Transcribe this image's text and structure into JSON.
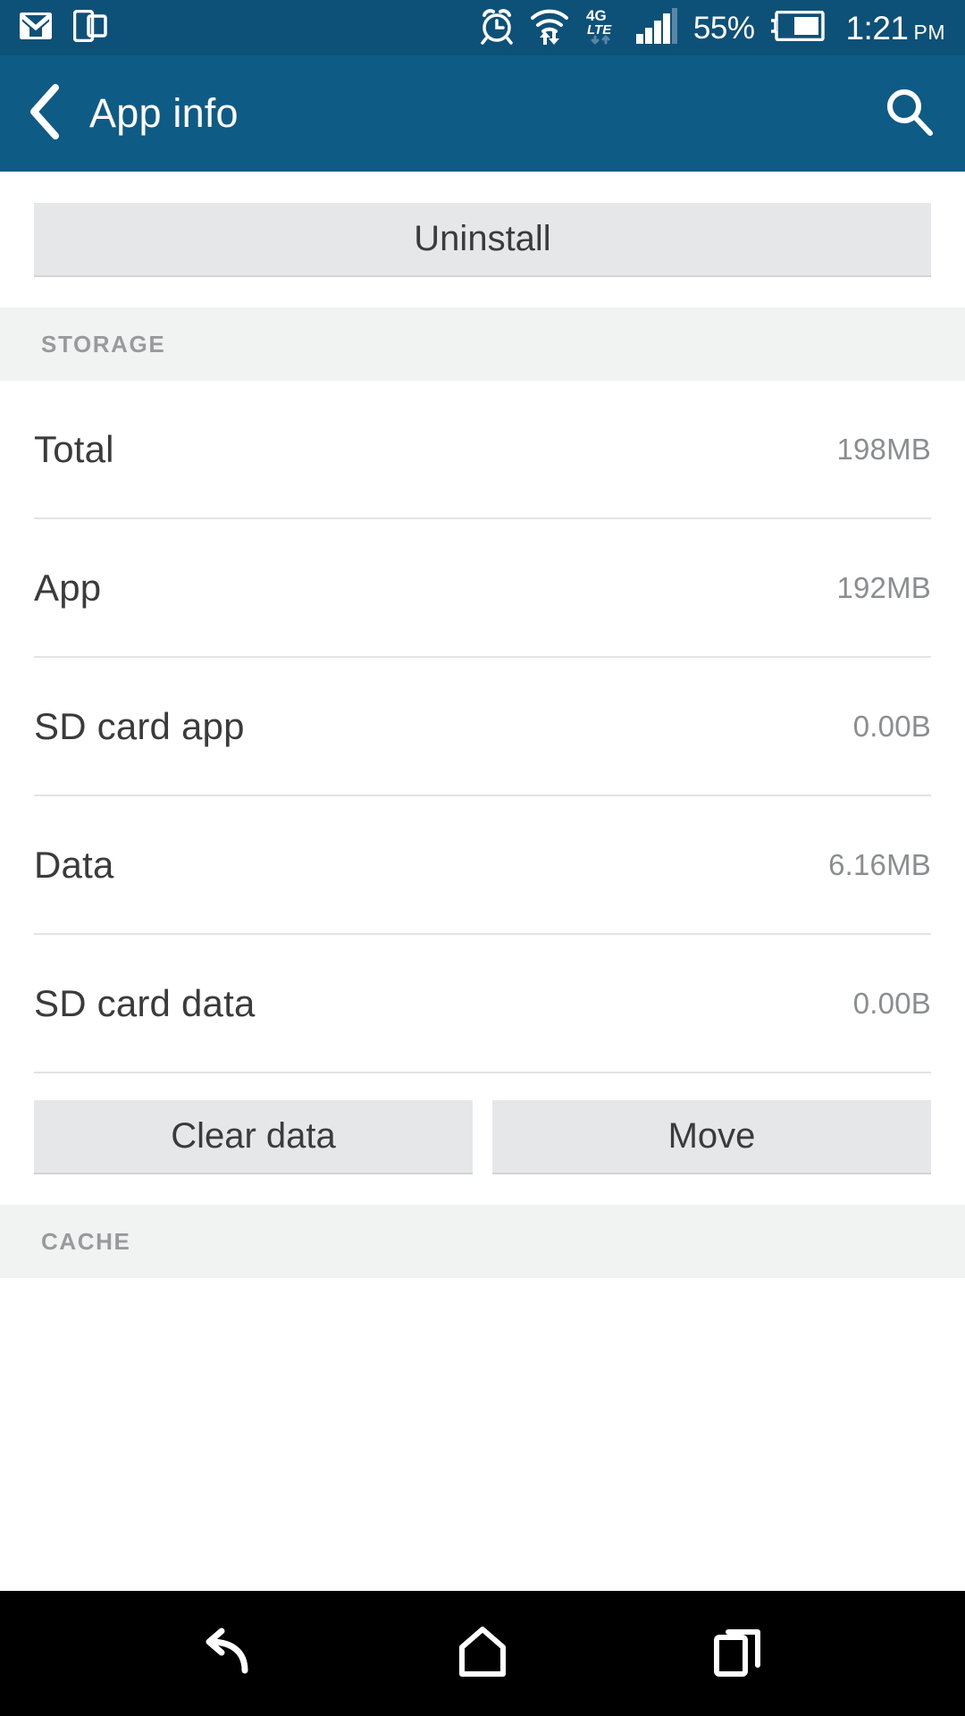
{
  "status_bar": {
    "background_color": "#0d5078",
    "left_icons": [
      {
        "name": "gmail-icon",
        "label": "Gmail"
      },
      {
        "name": "cast-screen-icon",
        "label": "Screen mirroring"
      }
    ],
    "right_icons": [
      {
        "name": "alarm-clock-icon",
        "label": "Alarm set"
      },
      {
        "name": "wifi-icon",
        "label": "Wi-Fi with data activity"
      },
      {
        "name": "4g-lte-icon",
        "label": "4G LTE"
      },
      {
        "name": "signal-bars-icon",
        "label": "Cellular signal"
      }
    ],
    "battery_percent": "55%",
    "battery_level": 55,
    "time": "1:21",
    "am_pm": "PM"
  },
  "app_bar": {
    "background_color": "#0e5c86",
    "back_label": "Back",
    "title": "App info",
    "search_label": "Search"
  },
  "main": {
    "uninstall_button": "Uninstall",
    "sections": [
      {
        "header": "STORAGE",
        "rows": [
          {
            "label": "Total",
            "value": "198MB"
          },
          {
            "label": "App",
            "value": "192MB"
          },
          {
            "label": "SD card app",
            "value": "0.00B"
          },
          {
            "label": "Data",
            "value": "6.16MB"
          },
          {
            "label": "SD card data",
            "value": "0.00B"
          }
        ],
        "actions": [
          {
            "label": "Clear data"
          },
          {
            "label": "Move"
          }
        ]
      },
      {
        "header": "CACHE",
        "rows": [],
        "actions": []
      }
    ]
  },
  "nav_bar": {
    "background_color": "#000000",
    "buttons": [
      {
        "name": "back-nav-icon",
        "label": "Back"
      },
      {
        "name": "home-nav-icon",
        "label": "Home"
      },
      {
        "name": "recents-nav-icon",
        "label": "Recent apps"
      }
    ]
  }
}
